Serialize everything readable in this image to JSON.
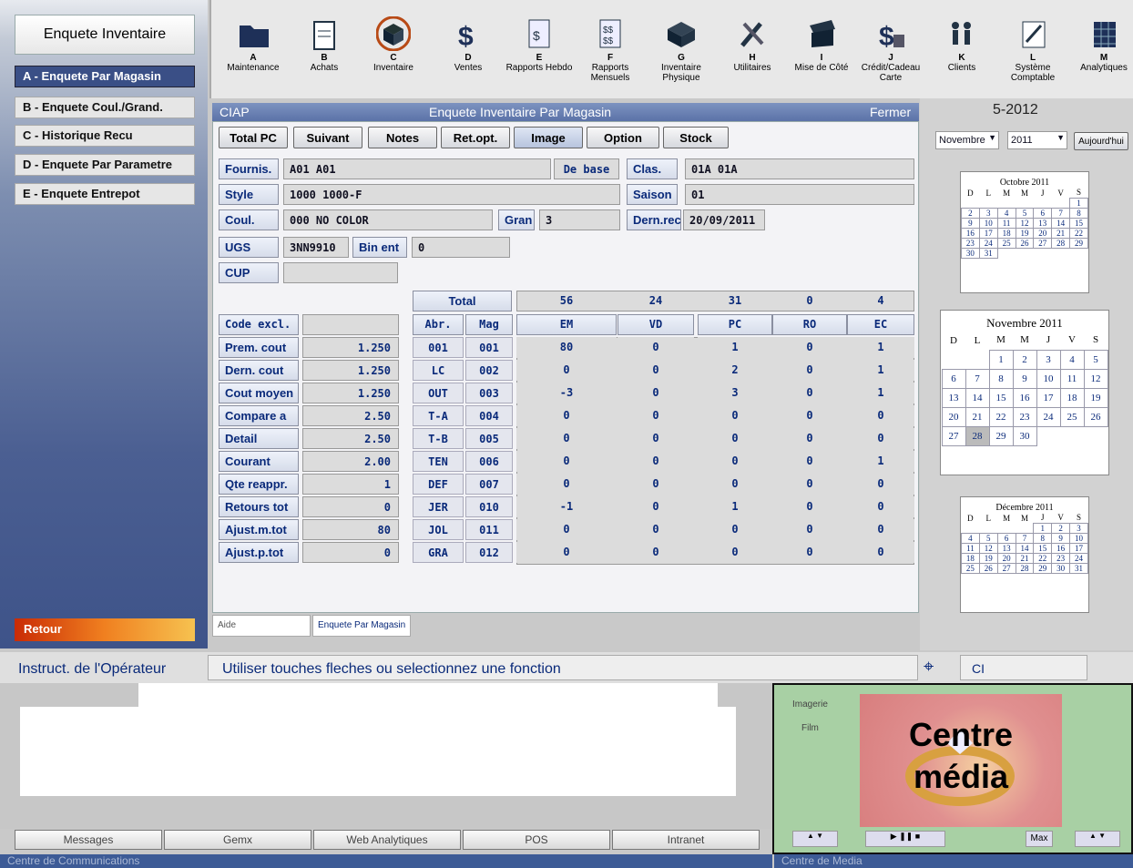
{
  "sidebar": {
    "title": "Enquete Inventaire",
    "items": [
      "A - Enquete Par Magasin",
      "B - Enquete Coul./Grand.",
      "C - Historique Recu",
      "D - Enquete Par Parametre",
      "E - Enquete Entrepot"
    ],
    "back": "Retour"
  },
  "toolbar": [
    {
      "l": "A",
      "n": "Maintenance",
      "i": "folder-icon"
    },
    {
      "l": "B",
      "n": "Achats",
      "i": "clipboard-icon"
    },
    {
      "l": "C",
      "n": "Inventaire",
      "i": "box-icon"
    },
    {
      "l": "D",
      "n": "Ventes",
      "i": "dollar-icon"
    },
    {
      "l": "E",
      "n": "Rapports Hebdo",
      "i": "report-icon"
    },
    {
      "l": "F",
      "n": "Rapports Mensuels",
      "i": "reports-icon"
    },
    {
      "l": "G",
      "n": "Inventaire Physique",
      "i": "cube-icon"
    },
    {
      "l": "H",
      "n": "Utilitaires",
      "i": "tools-icon"
    },
    {
      "l": "I",
      "n": "Mise de Côté",
      "i": "open-box-icon"
    },
    {
      "l": "J",
      "n": "Crédit/Cadeau Carte",
      "i": "card-dollar-icon"
    },
    {
      "l": "K",
      "n": "Clients",
      "i": "people-icon"
    },
    {
      "l": "L",
      "n": "Système Comptable",
      "i": "pen-paper-icon"
    },
    {
      "l": "M",
      "n": "Analytiques",
      "i": "grid-icon"
    }
  ],
  "header": {
    "company": "CIAP",
    "title": "Enquete Inventaire Par Magasin",
    "close": "Fermer"
  },
  "buttons": [
    "Total PC",
    "Suivant",
    "Notes",
    "Ret.opt.",
    "Image",
    "Option",
    "Stock"
  ],
  "form": {
    "fournis_l": "Fournis.",
    "fournis_v": "A01    A01",
    "debase": "De base",
    "clas_l": "Clas.",
    "clas_v": "01A  01A",
    "style_l": "Style",
    "style_v": "1000         1000-F",
    "saison_l": "Saison",
    "saison_v": "01",
    "coul_l": "Coul.",
    "coul_v": "000   NO COLOR",
    "gran_l": "Gran",
    "gran_v": "3",
    "dern_l": "Dern.rec",
    "dern_v": "20/09/2011",
    "ugs_l": "UGS",
    "ugs_v": "3NN9910",
    "bin_l": "Bin ent",
    "bin_v": "0",
    "cup_l": "CUP",
    "cup_v": ""
  },
  "costs": [
    [
      "Code excl.",
      ""
    ],
    [
      "Prem. cout",
      "1.250"
    ],
    [
      "Dern. cout",
      "1.250"
    ],
    [
      "Cout moyen",
      "1.250"
    ],
    [
      "Compare a",
      "2.50"
    ],
    [
      "Detail",
      "2.50"
    ],
    [
      "Courant",
      "2.00"
    ],
    [
      "Qte reappr.",
      "1"
    ],
    [
      "Retours tot",
      "0"
    ],
    [
      "Ajust.m.tot",
      "80"
    ],
    [
      "Ajust.p.tot",
      "0"
    ]
  ],
  "total": {
    "label": "Total",
    "values": [
      "56",
      "24",
      "31",
      "0",
      "4"
    ]
  },
  "cols": [
    "Abr.",
    "Mag",
    "EM",
    "VD",
    "PC",
    "RO",
    "EC"
  ],
  "rows": [
    [
      "001",
      "001",
      "80",
      "0",
      "1",
      "0",
      "1"
    ],
    [
      "LC",
      "002",
      "0",
      "0",
      "2",
      "0",
      "1"
    ],
    [
      "OUT",
      "003",
      "-3",
      "0",
      "3",
      "0",
      "1"
    ],
    [
      "T-A",
      "004",
      "0",
      "0",
      "0",
      "0",
      "0"
    ],
    [
      "T-B",
      "005",
      "0",
      "0",
      "0",
      "0",
      "0"
    ],
    [
      "TEN",
      "006",
      "0",
      "0",
      "0",
      "0",
      "1"
    ],
    [
      "DEF",
      "007",
      "0",
      "0",
      "0",
      "0",
      "0"
    ],
    [
      "JER",
      "010",
      "-1",
      "0",
      "1",
      "0",
      "0"
    ],
    [
      "JOL",
      "011",
      "0",
      "0",
      "0",
      "0",
      "0"
    ],
    [
      "GRA",
      "012",
      "0",
      "0",
      "0",
      "0",
      "0"
    ]
  ],
  "tabs": {
    "aide": "Aide",
    "current": "Enquete Par Magasin"
  },
  "date": {
    "display": "5-2012",
    "month": "Novembre",
    "year": "2011",
    "today": "Aujourd'hui"
  },
  "cal_oct": {
    "title": "Octobre 2011",
    "lead": 6,
    "days": 31,
    "hdr": [
      "D",
      "L",
      "M",
      "M",
      "J",
      "V",
      "S"
    ]
  },
  "cal_nov": {
    "title": "Novembre 2011",
    "lead": 2,
    "days": 30,
    "hdr": [
      "D",
      "L",
      "M",
      "M",
      "J",
      "V",
      "S"
    ],
    "today": "28"
  },
  "cal_dec": {
    "title": "Décembre 2011",
    "lead": 4,
    "days": 31,
    "hdr": [
      "D",
      "L",
      "M",
      "M",
      "J",
      "V",
      "S"
    ]
  },
  "instr": {
    "label": "Instruct. de l'Opérateur",
    "text": "Utiliser touches fleches ou selectionnez une fonction",
    "ci": "CI"
  },
  "comm_tabs": [
    "Messages",
    "Gemx",
    "Web Analytiques",
    "POS",
    "Intranet"
  ],
  "status": {
    "comm": "Centre de Communications",
    "media": "Centre de Media"
  },
  "media": {
    "tabs": [
      "Imagerie",
      "Film"
    ],
    "overlay": "Centre média",
    "max": "Max"
  },
  "colors": {
    "accent": "#3a4f86",
    "label": "#0a2a7a",
    "retour": "#e05010"
  }
}
